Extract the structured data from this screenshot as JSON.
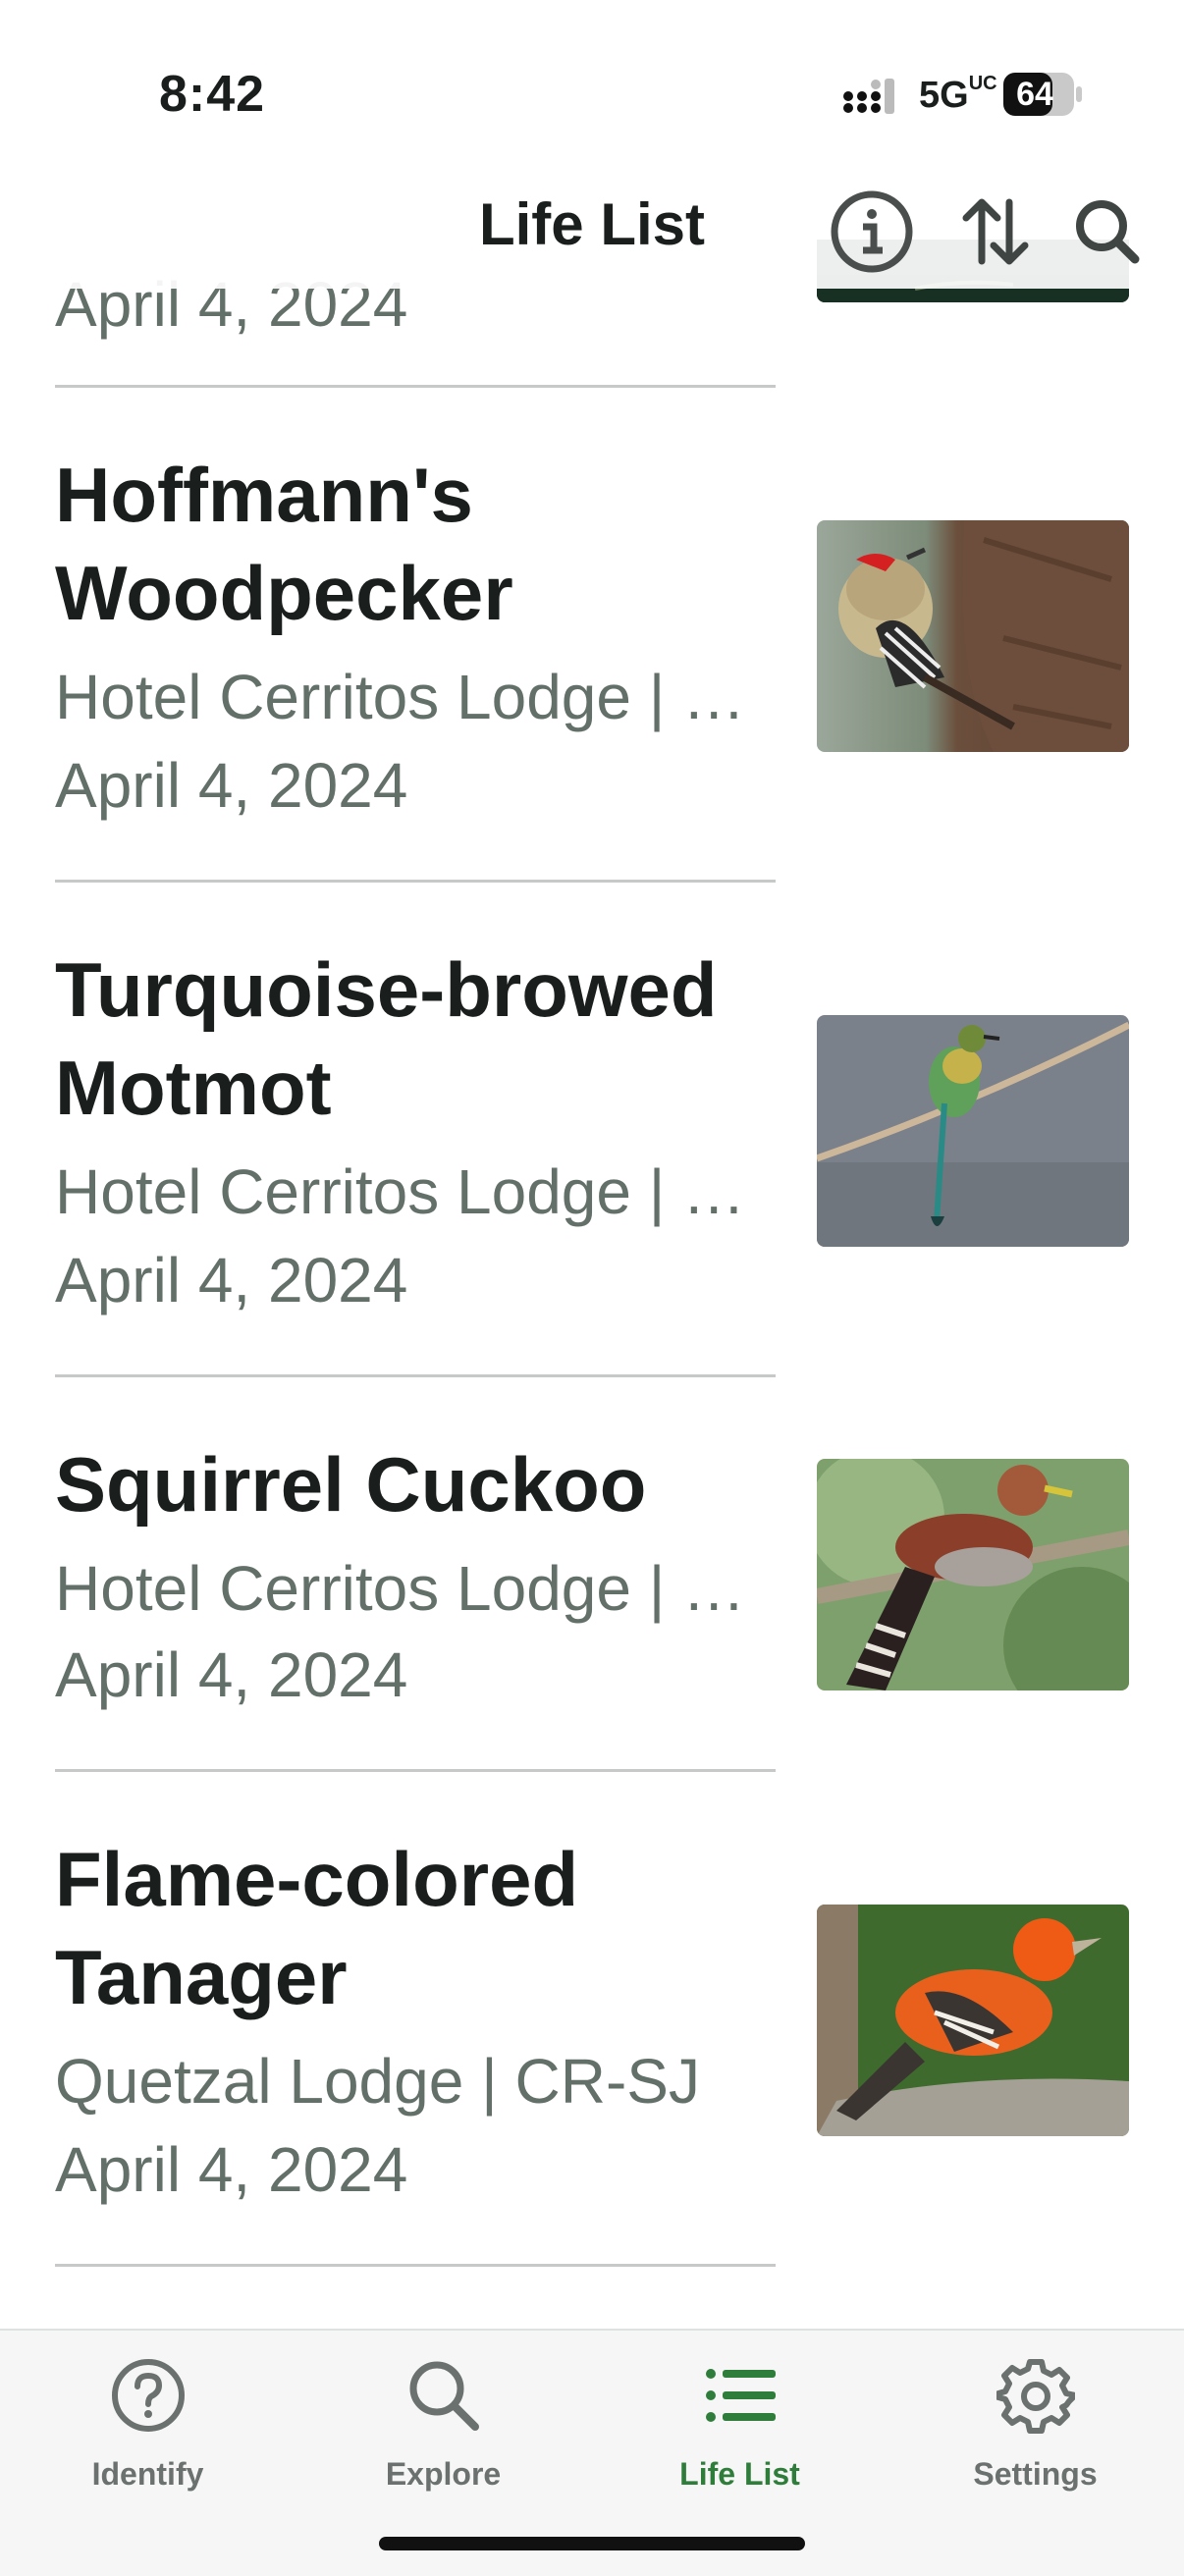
{
  "status_bar": {
    "time": "8:42",
    "network": "5G",
    "network_sup": "UC",
    "battery": "64"
  },
  "header": {
    "title": "Life List",
    "info_icon": "info-circle-icon",
    "sort_icon": "sort-arrows-icon",
    "search_icon": "search-icon"
  },
  "list": {
    "partial_top_date": "April 4, 2024",
    "items": [
      {
        "name": "Hoffmann's Woodpecker",
        "location": "Hotel Cerritos Lodge | CR-SJ",
        "date": "April 4, 2024"
      },
      {
        "name": "Turquoise-browed Motmot",
        "location": "Hotel Cerritos Lodge | CR-SJ",
        "date": "April 4, 2024"
      },
      {
        "name": "Squirrel Cuckoo",
        "location": "Hotel Cerritos Lodge | CR-SJ",
        "date": "April 4, 2024"
      },
      {
        "name": "Flame-colored Tanager",
        "location": "Quetzal Lodge | CR-SJ",
        "date": "April 4, 2024"
      }
    ]
  },
  "tabbar": {
    "tabs": [
      {
        "label": "Identify",
        "icon": "question-circle-icon"
      },
      {
        "label": "Explore",
        "icon": "search-icon"
      },
      {
        "label": "Life List",
        "icon": "list-icon"
      },
      {
        "label": "Settings",
        "icon": "gear-icon"
      }
    ],
    "active": "Life List"
  },
  "colors": {
    "accent": "#2f7d3b",
    "secondary_text": "#637069",
    "tab_inactive": "#6b716f"
  }
}
